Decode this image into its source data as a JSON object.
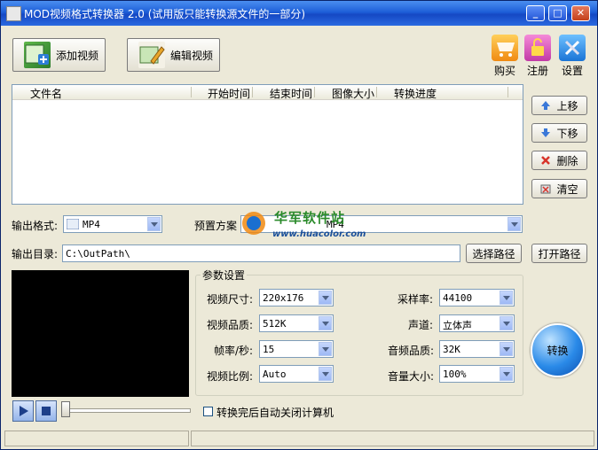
{
  "window": {
    "title": "MOD视频格式转换器 2.0 (试用版只能转换源文件的一部分)",
    "controls": [
      "_",
      "□",
      "✕"
    ]
  },
  "toolbar": {
    "add_video": "添加视频",
    "edit_video": "编辑视频",
    "buy": "购买",
    "register": "注册",
    "settings": "设置"
  },
  "file_list": {
    "columns": [
      "文件名",
      "开始时间",
      "结束时间",
      "图像大小",
      "转换进度"
    ]
  },
  "side_buttons": {
    "move_up": "上移",
    "move_down": "下移",
    "delete": "删除",
    "clear": "清空"
  },
  "output": {
    "format_label": "输出格式:",
    "format_value": "MP4",
    "preset_label": "预置方案",
    "preset_value": "MP4",
    "dir_label": "输出目录:",
    "dir_value": "C:\\OutPath\\",
    "choose_path": "选择路径",
    "open_path": "打开路径"
  },
  "params": {
    "title": "参数设置",
    "video_size_label": "视频尺寸:",
    "video_size": "220x176",
    "video_quality_label": "视频品质:",
    "video_quality": "512K",
    "fps_label": "帧率/秒:",
    "fps": "15",
    "aspect_label": "视频比例:",
    "aspect": "Auto",
    "sample_rate_label": "采样率:",
    "sample_rate": "44100",
    "channel_label": "声道:",
    "channel": "立体声",
    "audio_quality_label": "音频品质:",
    "audio_quality": "32K",
    "volume_label": "音量大小:",
    "volume": "100%"
  },
  "convert_button": "转换",
  "auto_shutdown_label": "转换完后自动关闭计算机",
  "auto_shutdown_checked": false,
  "watermark": {
    "brand": "华军软件站",
    "url": "www.huacolor.com"
  },
  "colors": {
    "title_bar": "#1e5fd8",
    "window_bg": "#ece9d8",
    "preview_bg": "#000000"
  }
}
